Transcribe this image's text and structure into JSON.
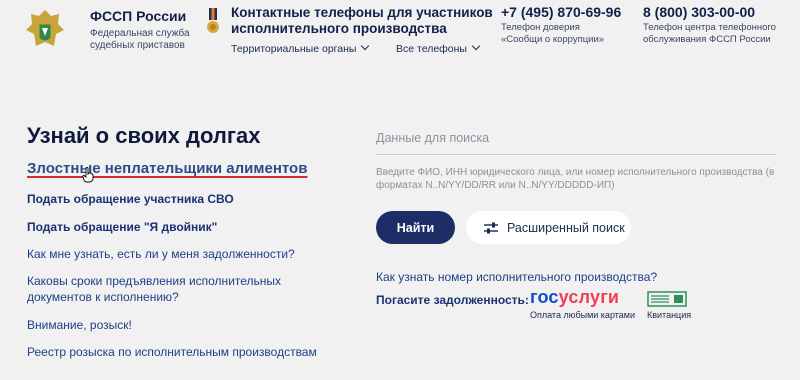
{
  "header": {
    "logo_title": "ФССП России",
    "logo_subtitle": "Федеральная служба судебных приставов",
    "contacts_title": "Контактные телефоны для участников исполнительного производства",
    "dropdowns": [
      "Территориальные органы",
      "Все телефоны"
    ],
    "phones": [
      {
        "number": "+7 (495) 870-69-96",
        "desc": "Телефон доверия «Сообщи о коррупции»"
      },
      {
        "number": "8 (800) 303-00-00",
        "desc": "Телефон центра телефонного обслуживания ФССП России"
      }
    ]
  },
  "main": {
    "heading": "Узнай о своих долгах",
    "featured_link": "Злостные неплательщики алиментов",
    "links": [
      {
        "label": "Подать обращение участника СВО",
        "bold": true
      },
      {
        "label": "Подать обращение \"Я двойник\"",
        "bold": true
      },
      {
        "label": "Как мне узнать, есть ли у меня задолженности?",
        "bold": false
      },
      {
        "label": "Каковы сроки предъявления исполнительных документов к исполнению?",
        "bold": false
      },
      {
        "label": "Внимание, розыск!",
        "bold": false
      },
      {
        "label": "Реестр розыска по исполнительным производствам",
        "bold": false
      }
    ]
  },
  "search": {
    "placeholder": "Данные для поиска",
    "value": "",
    "hint": "Введите ФИО, ИНН юридического лица, или номер исполнительного производства (в форматах N..N/YY/DD/RR или N..N/YY/DDDDD-ИП)",
    "find_label": "Найти",
    "advanced_label": "Расширенный поиск",
    "howto_link": "Как узнать номер исполнительного производства?",
    "pay_label": "Погасите задолженность:",
    "gosuslugi_part1": "гос",
    "gosuslugi_part2": "услуги",
    "gosuslugi_caption": "Оплата любыми картами",
    "receipt_caption": "Квитанция"
  },
  "colors": {
    "primary": "#1e2d66",
    "link": "#1e3f86",
    "accent_red": "#d0312d",
    "background": "#f1f1f1"
  }
}
